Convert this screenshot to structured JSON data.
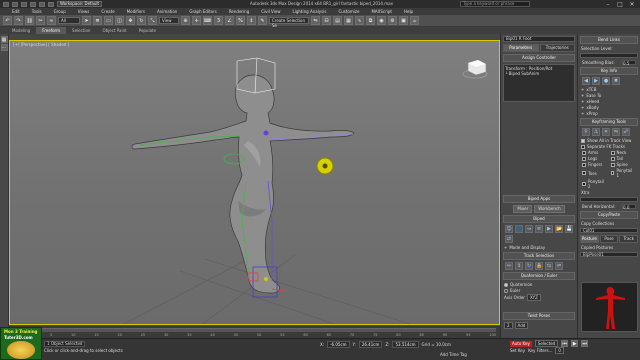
{
  "titlebar": {
    "workspace": "Workspace: Default",
    "title": "Autodesk 3ds Max Design 2014 x64     BR1_girl fantastic biped_2014.max",
    "search_placeholder": "Type a keyword or phrase",
    "min": "–",
    "max": "□",
    "close": "✕"
  },
  "menu": [
    "Edit",
    "Tools",
    "Group",
    "Views",
    "Create",
    "Modifiers",
    "Animation",
    "Graph Editors",
    "Rendering",
    "Civil View",
    "Lighting Analysis",
    "Customize",
    "MAXScript",
    "Help"
  ],
  "toolbar": {
    "filter": "All",
    "view": "View",
    "named_selection": "Create Selection Se"
  },
  "ribbon": {
    "tabs": [
      {
        "label": "Modeling",
        "on": false
      },
      {
        "label": "Freeform",
        "on": true
      },
      {
        "label": "Selection",
        "on": false
      },
      {
        "label": "Object Paint",
        "on": false
      },
      {
        "label": "Populate",
        "on": false
      }
    ]
  },
  "viewport": {
    "label": "[+] [Perspective] [ Shaded ]",
    "border_color": "#d9c700"
  },
  "timeline": {
    "slider": "0 / 100",
    "ticks": [
      "0",
      "5",
      "10",
      "15",
      "20",
      "25",
      "30",
      "35",
      "40",
      "45",
      "50",
      "55",
      "60",
      "65",
      "70",
      "75",
      "80",
      "85",
      "90",
      "95",
      "100"
    ]
  },
  "status": {
    "selected": "1 Object Selected",
    "hint": "Click or click-and-drag to select objects",
    "x": "-6.05cm",
    "y": "26.41cm",
    "z": "53.514cm",
    "grid": "Grid = 10.0cm",
    "autokey": "Auto Key",
    "selected_dd": "Selected",
    "setkey": "Set Key",
    "key_filters": "Key Filters...",
    "frame": "0",
    "add_time_tag": "Add Time Tag"
  },
  "logo": {
    "line1": "Mon 3 Training",
    "line2": "Tuter3D.com"
  },
  "panel": {
    "object_name": "Bip01 R Foot",
    "tabs": [
      {
        "label": "Parameters",
        "on": true
      },
      {
        "label": "Trajectories",
        "on": false
      }
    ],
    "assign_controller": "Assign Controller",
    "controller_list": [
      "Transform : Position/Rot",
      "└ Biped SubAnim"
    ],
    "biped_apps": "Biped Apps",
    "apps_buttons": [
      "Mixer",
      "Workbench"
    ],
    "biped": "Biped",
    "biped_mode": "Mode and Display",
    "track_selection": "Track Selection",
    "quaternion_euler": "Quaternion / Euler",
    "quaternion": "Quaternion",
    "euler": "Euler",
    "axis_order_label": "Axis Order",
    "axis_order": "XYZ",
    "twist_poses": "Twist Poses",
    "twist_value": "2",
    "twist_btn": "Add"
  },
  "panel2": {
    "bend_links": "Bend Links",
    "selection_level": "Selection Level:",
    "smoothing_bias": "Smoothing Bias:",
    "smoothing_value": "0.5",
    "key_info": "Key Info",
    "tcb": [
      "xTCB",
      "Ease To",
      "xHeed",
      "xBody",
      "xProp"
    ],
    "keyframing_tools": "Keyframing Tools",
    "show_all": "Show All in Track View",
    "separate_fk": "Separate FK Tracks",
    "fk_tracks": [
      "Arms",
      "Neck",
      "Legs",
      "Tail",
      "Fingers",
      "Spine",
      "Toes",
      "Ponytail 1",
      "Ponytail 2"
    ],
    "xtra_label": "Xtra",
    "bend_horizontal": "Bend Horizontal:",
    "bend_horizontal_value": "0.0",
    "copy_paste": "Copy/Paste",
    "copy_collections": "Copy Collections",
    "collection": "Col01",
    "modes": [
      "Posture",
      "Pose",
      "Track"
    ],
    "copied_postures": "Copied Postures",
    "posture_name": "BipPose01",
    "figure_color": "#cc1111"
  }
}
